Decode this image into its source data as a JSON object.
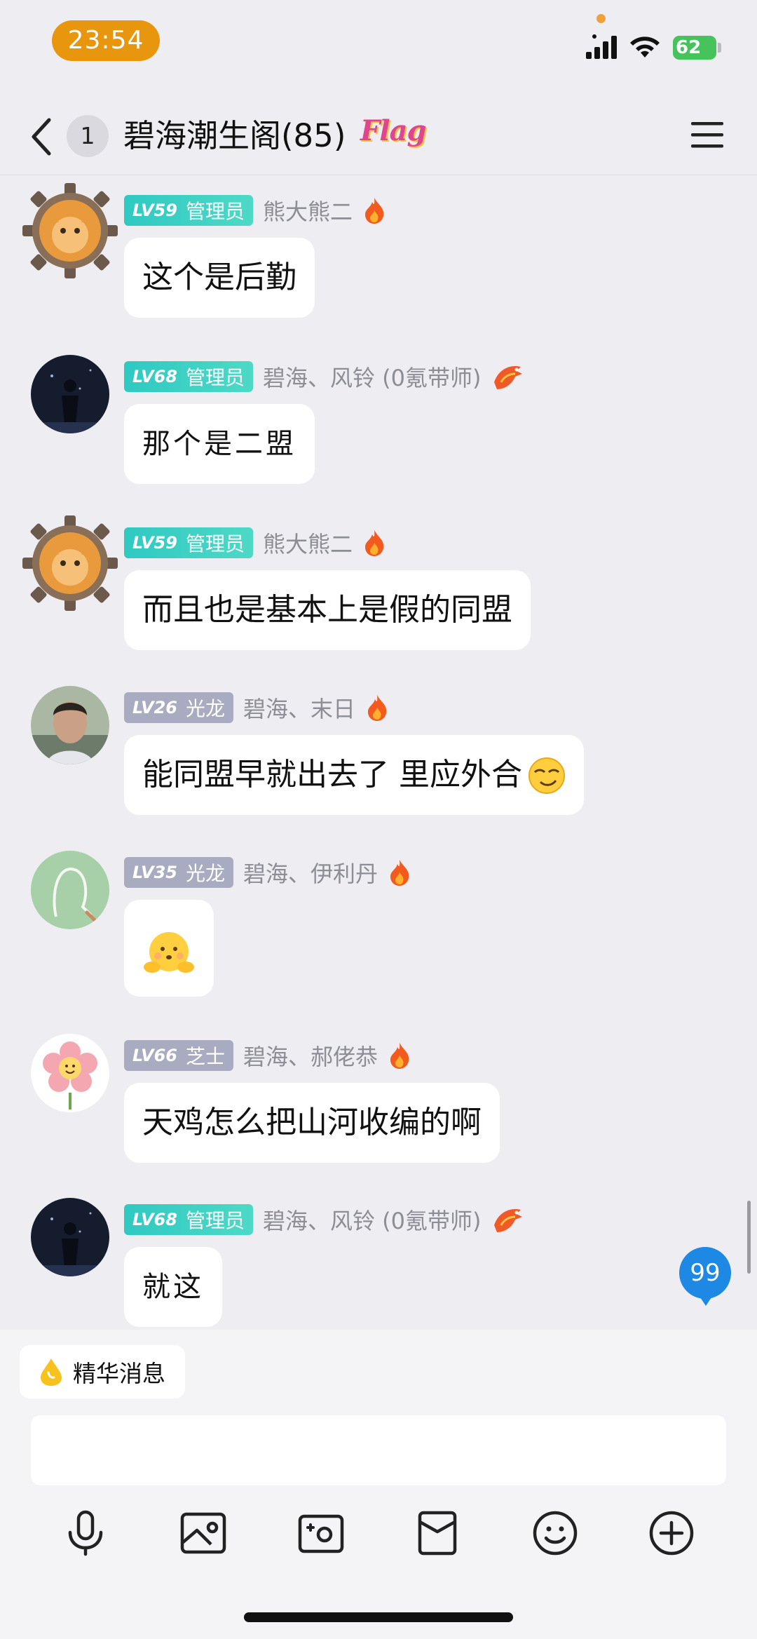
{
  "status_bar": {
    "time": "23:54",
    "battery": "62"
  },
  "header": {
    "unread_count": "1",
    "title": "碧海潮生阁(85)",
    "tag": "Flag"
  },
  "messages": [
    {
      "level": "LV59",
      "role": "管理员",
      "sender": "熊大熊二",
      "text": "这个是后勤"
    },
    {
      "level": "LV68",
      "role": "管理员",
      "sender": "碧海、风铃 (0氪带师)",
      "text": "那个是二盟"
    },
    {
      "level": "LV59",
      "role": "管理员",
      "sender": "熊大熊二",
      "text": "而且也是基本上是假的同盟"
    },
    {
      "level": "LV26",
      "role": "光龙",
      "sender": "碧海、末日",
      "text": "能同盟早就出去了 里应外合"
    },
    {
      "level": "LV35",
      "role": "光龙",
      "sender": "碧海、伊利丹",
      "text": ""
    },
    {
      "level": "LV66",
      "role": "芝士",
      "sender": "碧海、郝佬恭",
      "text": "天鸡怎么把山河收编的啊"
    },
    {
      "level": "LV68",
      "role": "管理员",
      "sender": "碧海、风铃 (0氪带师)",
      "text": "就这"
    }
  ],
  "new_message_count": "99",
  "essence": {
    "label": "精华消息"
  },
  "input": {
    "placeholder": ""
  },
  "toolbar": [
    "microphone-icon",
    "image-icon",
    "camera-icon",
    "red-packet-icon",
    "emoji-icon",
    "plus-icon"
  ],
  "colors": {
    "admin_badge": "#2fc9c2",
    "member_badge": "#a9abc0",
    "accent": "#1e88e5",
    "time_pill": "#e8960e"
  }
}
